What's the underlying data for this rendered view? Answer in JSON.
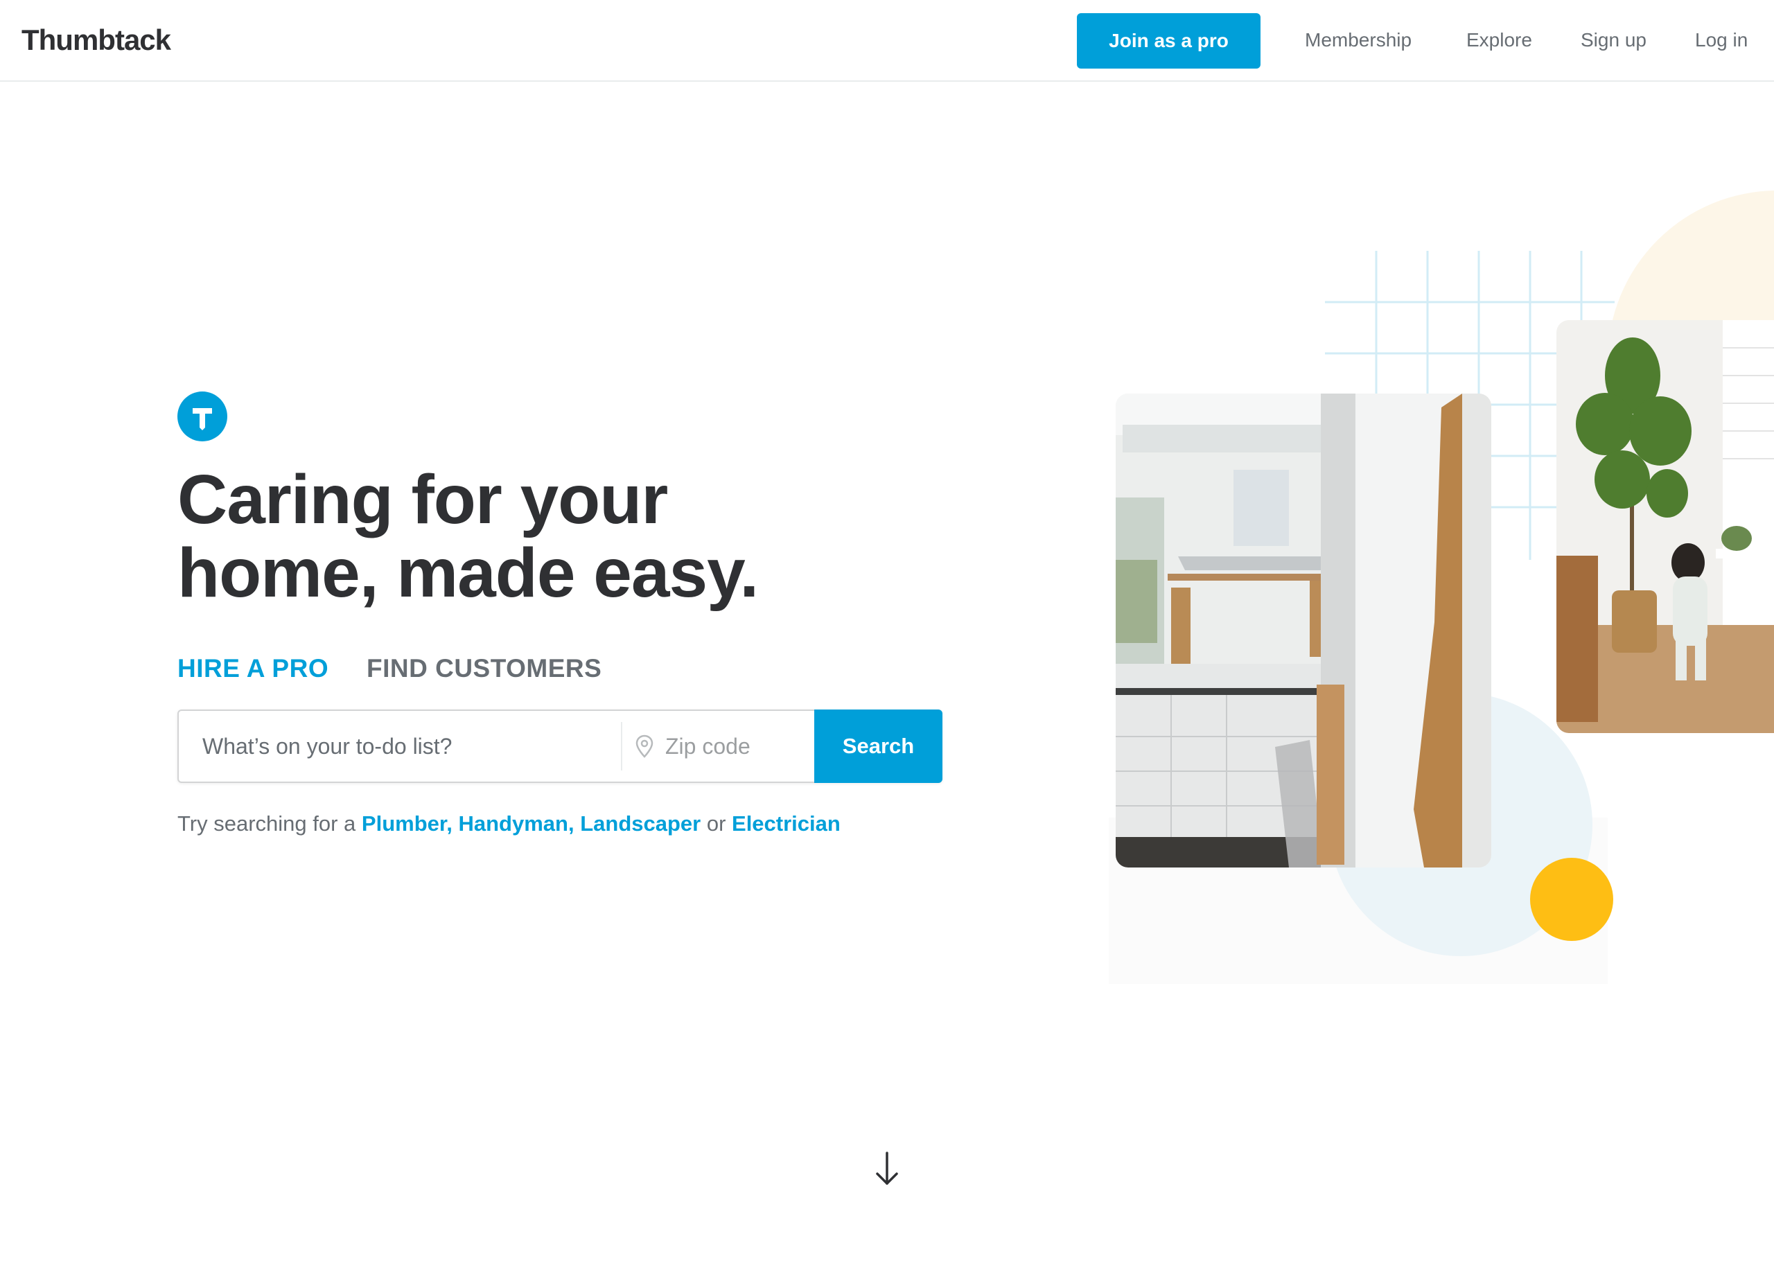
{
  "header": {
    "logo": "Thumbtack",
    "join_label": "Join as a pro",
    "nav": {
      "membership": "Membership",
      "explore": "Explore",
      "signup": "Sign up",
      "login": "Log in"
    }
  },
  "hero": {
    "headline_line1": "Caring for your",
    "headline_line2": "home, made easy.",
    "tabs": {
      "hire": "HIRE A PRO",
      "find": "FIND CUSTOMERS"
    },
    "search": {
      "todo_placeholder": "What’s on your to-do list?",
      "zip_placeholder": "Zip code",
      "button_label": "Search"
    },
    "suggest": {
      "prefix": "Try searching for a ",
      "link1": "Plumber,",
      "link2": "Handyman,",
      "link3": "Landscaper",
      "joiner": " or ",
      "link4": "Electrician"
    }
  },
  "icons": {
    "brand": "thumbtack-t-icon",
    "location": "map-pin-icon",
    "scroll": "arrow-down-icon"
  },
  "colors": {
    "brand_blue": "#009fd9",
    "text_dark": "#2f3033",
    "text_gray": "#676d73",
    "accent_yellow": "#febe14",
    "pale_blue": "#e7f3f8",
    "pale_cream": "#fdf6e6"
  }
}
